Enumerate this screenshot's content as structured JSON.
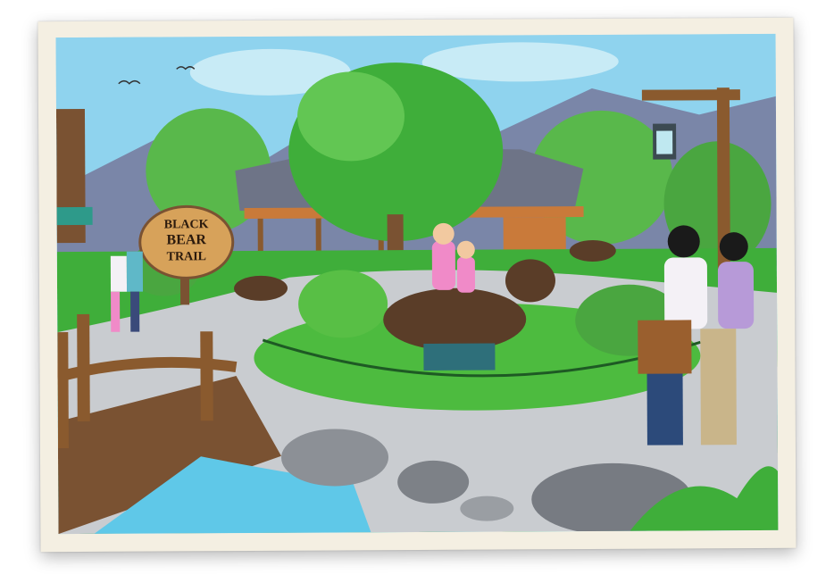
{
  "scene": {
    "sign_lines": [
      "BLACK",
      "BEAR",
      "TRAIL"
    ],
    "colors": {
      "sky": "#8fd3ee",
      "mountain": "#7a86a8",
      "grass": "#3fae3a",
      "path": "#c9ccd0",
      "water": "#5fc8e8",
      "bear": "#5a3d28",
      "wood": "#8a5a2e",
      "sign": "#d7a25a"
    }
  }
}
